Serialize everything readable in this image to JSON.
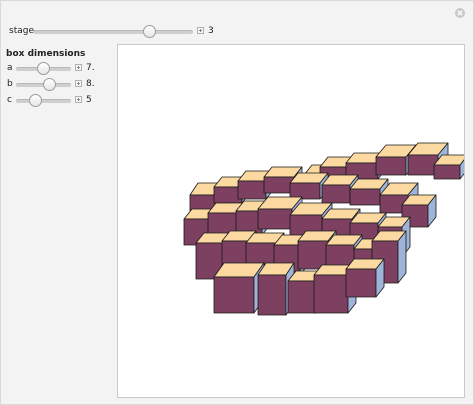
{
  "controls": {
    "stage": {
      "label": "stage",
      "value": "3"
    },
    "box_dimensions": {
      "heading": "box dimensions",
      "a": {
        "label": "a",
        "value": "7."
      },
      "b": {
        "label": "b",
        "value": "8."
      },
      "c": {
        "label": "c",
        "value": "5"
      }
    }
  },
  "colors": {
    "top_face": "#fbd9a0",
    "side_dark": "#7d4060",
    "side_light": "#9fb4d9",
    "edge": "#1a1a1a"
  },
  "icons": {
    "close": "close-icon",
    "plus": "plus-icon"
  }
}
